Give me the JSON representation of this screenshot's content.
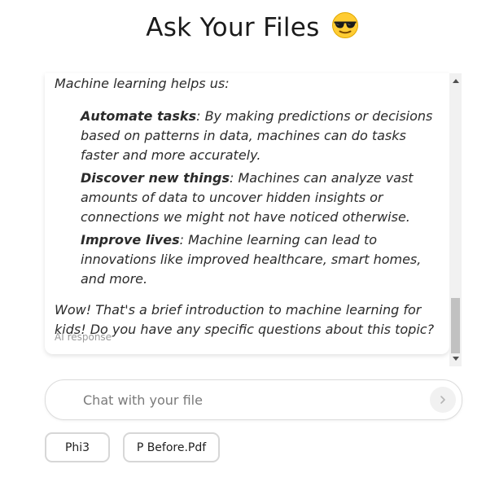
{
  "header": {
    "title": "Ask Your Files",
    "emoji_icon": "sunglasses-face-icon"
  },
  "message": {
    "intro": "Machine learning helps us:",
    "bullets": [
      {
        "term": "Automate tasks",
        "text": ": By making predictions or decisions based on patterns in data, machines can do tasks faster and more accurately."
      },
      {
        "term": "Discover new things",
        "text": ": Machines can analyze vast amounts of data to uncover hidden insights or connections we might not have noticed otherwise."
      },
      {
        "term": "Improve lives",
        "text": ": Machine learning can lead to innovations like improved healthcare, smart homes, and more."
      }
    ],
    "outro": "Wow! That's a brief introduction to machine learning for kids! Do you have any specific questions about this topic?",
    "label": "AI response"
  },
  "input": {
    "placeholder": "Chat with your file",
    "value": "",
    "send_icon": "chevron-right-icon"
  },
  "chips": {
    "model": "Phi3",
    "file": "P Before.Pdf"
  },
  "colors": {
    "chip_border": "#d7d7d7",
    "scrollbar_track": "#f1f1f1",
    "scrollbar_thumb": "#c1c1c1",
    "label_gray": "#9a9a9a"
  }
}
